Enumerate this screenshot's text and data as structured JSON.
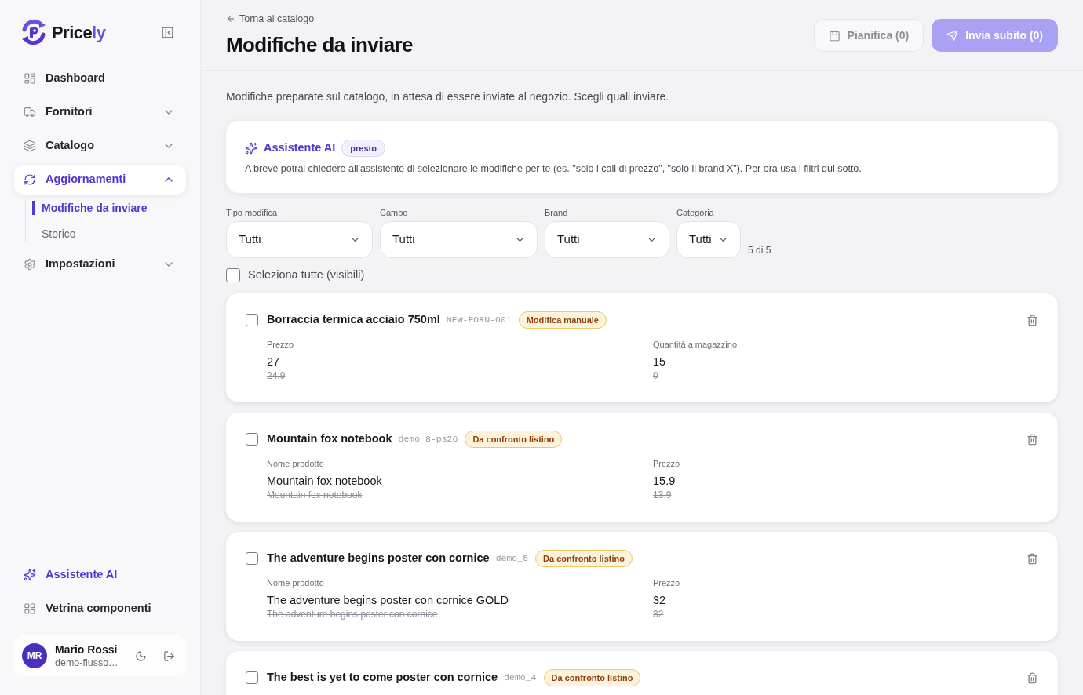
{
  "sidebar": {
    "logo": {
      "text_part_1": "Price",
      "text_part_2": "ly"
    },
    "nav": [
      {
        "label": "Dashboard",
        "selected": false
      },
      {
        "label": "Fornitori",
        "selected": false,
        "expanded": false
      },
      {
        "label": "Catalogo",
        "selected": false,
        "expanded": false
      },
      {
        "label": "Aggiornamenti",
        "selected": true,
        "expanded": true,
        "children": [
          {
            "label": "Modifiche da inviare",
            "selected": true
          },
          {
            "label": "Storico",
            "selected": false
          }
        ]
      },
      {
        "label": "Impostazioni",
        "selected": false,
        "expanded": false
      }
    ],
    "bottom_nav": [
      {
        "label": "Assistente AI",
        "kind": "ai"
      },
      {
        "label": "Vetrina componenti",
        "kind": "link"
      }
    ],
    "user": {
      "initials": "MR",
      "name": "Mario Rossi",
      "subtitle": "demo-flusso…"
    }
  },
  "header": {
    "back_link": "Torna al catalogo",
    "title": "Modifiche da inviare",
    "actions": [
      {
        "label": "Pianifica (0)",
        "kind": "secondary",
        "disabled": true
      },
      {
        "label": "Invia subito (0)",
        "kind": "primary",
        "disabled": true
      }
    ]
  },
  "description": "Modifiche preparate sul catalogo, in attesa di essere inviate al negozio. Scegli quali inviare.",
  "ai_card": {
    "title": "Assistente AI",
    "badge": "presto",
    "text": "A breve potrai chiedere all'assistente di selezionare le modifiche per te (es. \"solo i cali di prezzo\", \"solo il brand X\"). Per ora usa i filtri qui sotto."
  },
  "filters": {
    "fields": [
      {
        "label": "Tipo modifica",
        "value": "Tutti"
      },
      {
        "label": "Campo",
        "value": "Tutti"
      },
      {
        "label": "Brand",
        "value": "Tutti"
      },
      {
        "label": "Categoria",
        "value": "Tutti"
      }
    ],
    "count": "5 di 5"
  },
  "select_all": {
    "label": "Seleziona tutte (visibili)",
    "checked": false
  },
  "changes": [
    {
      "title": "Borraccia termica acciaio 750ml",
      "code": "NEW-FORN-001",
      "badge": "Modifica manuale",
      "checked": false,
      "fields": [
        {
          "label": "Prezzo",
          "new": "27",
          "old": "24.9"
        },
        {
          "label": "Quantità a magazzino",
          "new": "15",
          "old": "0"
        }
      ]
    },
    {
      "title": "Mountain fox notebook",
      "code": "demo_8-ps26",
      "badge": "Da confronto listino",
      "checked": false,
      "fields": [
        {
          "label": "Nome prodotto",
          "new": "Mountain fox notebook",
          "old": "Mountain fox notebook"
        },
        {
          "label": "Prezzo",
          "new": "15.9",
          "old": "13.9"
        }
      ]
    },
    {
      "title": "The adventure begins poster con cornice",
      "code": "demo_5",
      "badge": "Da confronto listino",
      "checked": false,
      "fields": [
        {
          "label": "Nome prodotto",
          "new": "The adventure begins poster con cornice GOLD",
          "old": "The adventure begins poster con cornice"
        },
        {
          "label": "Prezzo",
          "new": "32",
          "old": "32"
        }
      ]
    },
    {
      "title": "The best is yet to come poster con cornice",
      "code": "demo_4",
      "badge": "Da confronto listino",
      "checked": false
    }
  ]
}
